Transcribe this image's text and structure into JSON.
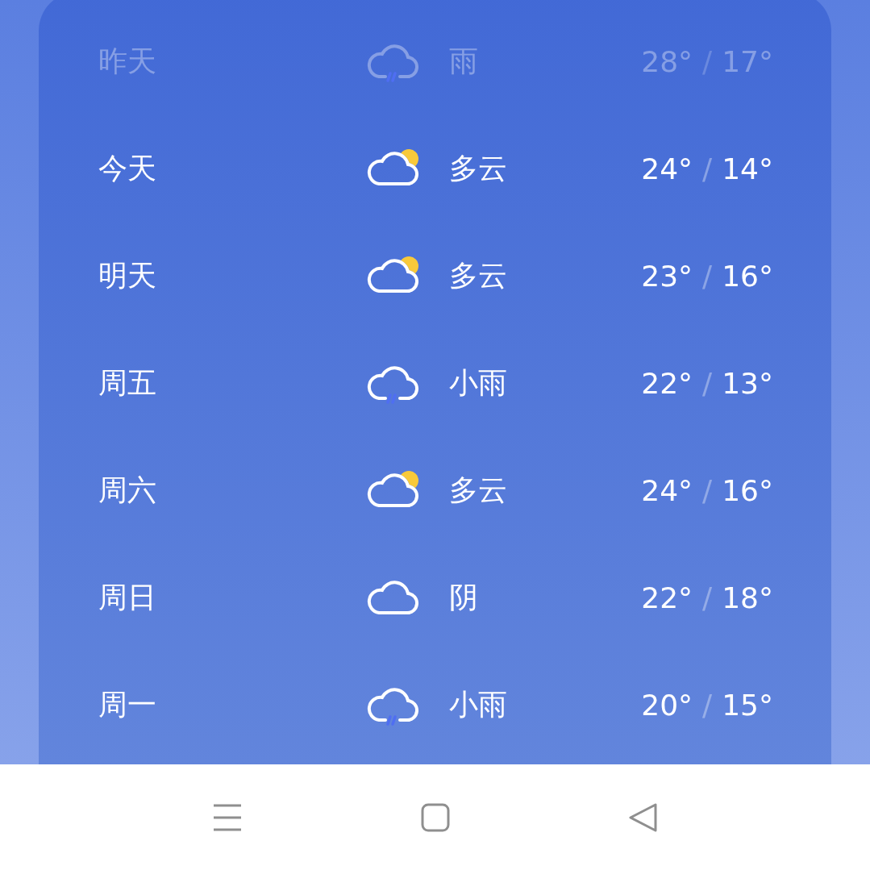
{
  "forecast": [
    {
      "day": "昨天",
      "kind": "rain",
      "condition": "雨",
      "high": "28°",
      "separator": "/",
      "low": "17°",
      "past": true
    },
    {
      "day": "今天",
      "kind": "partly-cloudy",
      "condition": "多云",
      "high": "24°",
      "separator": "/",
      "low": "14°",
      "past": false
    },
    {
      "day": "明天",
      "kind": "partly-cloudy",
      "condition": "多云",
      "high": "23°",
      "separator": "/",
      "low": "16°",
      "past": false
    },
    {
      "day": "周五",
      "kind": "rain",
      "condition": "小雨",
      "high": "22°",
      "separator": "/",
      "low": "13°",
      "past": false
    },
    {
      "day": "周六",
      "kind": "partly-cloudy",
      "condition": "多云",
      "high": "24°",
      "separator": "/",
      "low": "16°",
      "past": false
    },
    {
      "day": "周日",
      "kind": "cloudy",
      "condition": "阴",
      "high": "22°",
      "separator": "/",
      "low": "18°",
      "past": false
    },
    {
      "day": "周一",
      "kind": "rain",
      "condition": "小雨",
      "high": "20°",
      "separator": "/",
      "low": "15°",
      "past": false
    }
  ],
  "nav_bar": [
    {
      "kind": "menu"
    },
    {
      "kind": "home"
    },
    {
      "kind": "back"
    }
  ]
}
